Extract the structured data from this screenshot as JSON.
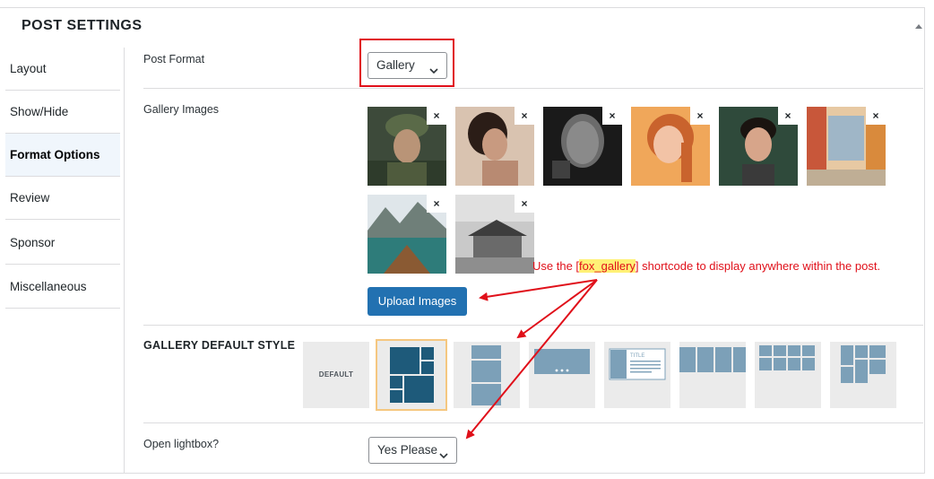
{
  "panel": {
    "title": "POST SETTINGS"
  },
  "sidebar": {
    "tabs": [
      {
        "label": "Layout"
      },
      {
        "label": "Show/Hide"
      },
      {
        "label": "Format Options",
        "active": true
      },
      {
        "label": "Review"
      },
      {
        "label": "Sponsor"
      },
      {
        "label": "Miscellaneous"
      }
    ]
  },
  "post_format": {
    "label": "Post Format",
    "value": "Gallery"
  },
  "gallery_images": {
    "label": "Gallery Images",
    "remove_glyph": "×",
    "upload_label": "Upload Images",
    "note_prefix": "Use the [",
    "note_code": "fox_gallery",
    "note_suffix": "] shortcode to display anywhere within the post."
  },
  "gallery_style": {
    "title": "GALLERY DEFAULT STYLE",
    "default_label": "DEFAULT",
    "title_label": "TITLE"
  },
  "lightbox": {
    "label": "Open lightbox?",
    "value": "Yes Please"
  },
  "colors": {
    "accent": "#2271b1",
    "highlight": "#e0101a",
    "selected_border": "#f5c780",
    "style_icon": "#1e5a7a"
  }
}
